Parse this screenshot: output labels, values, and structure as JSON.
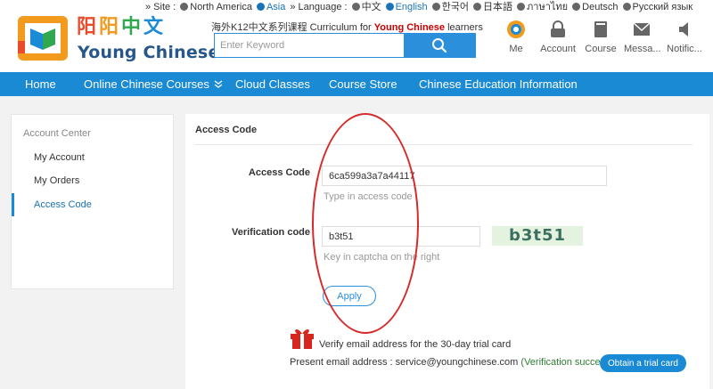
{
  "header": {
    "site_label": "» Site :",
    "sites": [
      {
        "label": "North America",
        "active": false
      },
      {
        "label": "Asia",
        "active": true
      }
    ],
    "language_label": "» Language :",
    "languages": [
      {
        "label": "中文",
        "active": false
      },
      {
        "label": "English",
        "active": true
      },
      {
        "label": "한국어",
        "active": false
      },
      {
        "label": "日本語",
        "active": false
      },
      {
        "label": "ภาษาไทย",
        "active": false
      },
      {
        "label": "Deutsch",
        "active": false
      },
      {
        "label": "Русский язык",
        "active": false
      }
    ],
    "logo_chars": [
      "阳",
      "阳",
      "中",
      "文"
    ],
    "logo_colors": [
      "#e94c2b",
      "#f29a1e",
      "#2fa84f",
      "#1b8bd6"
    ],
    "logo_text": "Young Chinese",
    "tagline_prefix": "海外K12中文系列课程 Curriculum for ",
    "tagline_brand": "Young Chinese",
    "tagline_suffix": " learners",
    "search_placeholder": "Enter Keyword",
    "user_nav": [
      {
        "label": "Me",
        "icon": "avatar-icon"
      },
      {
        "label": "Account",
        "icon": "account-icon"
      },
      {
        "label": "Course",
        "icon": "book-icon"
      },
      {
        "label": "Messa...",
        "icon": "mail-icon"
      },
      {
        "label": "Notific...",
        "icon": "speaker-icon"
      }
    ]
  },
  "nav": {
    "items": [
      "Home",
      "Online Chinese Courses",
      "Cloud Classes",
      "Course Store",
      "Chinese Education Information"
    ]
  },
  "sidebar": {
    "title": "Account Center",
    "items": [
      "My Account",
      "My Orders",
      "Access Code"
    ],
    "active_item": "Access Code"
  },
  "main": {
    "title": "Access Code",
    "access_code_label": "Access Code",
    "access_code_value": "6ca599a3a7a44117",
    "access_code_hint": "Type in access code",
    "verification_label": "Verification code",
    "verification_value": "b3t51",
    "verification_hint": "Key in captcha on the right",
    "captcha_text": "b3t51",
    "apply_label": "Apply",
    "trial_text": "Verify email address for the 30-day trial card",
    "email_prefix": "Present email address : service@youngchinese.com",
    "email_status": "(Verification successful)",
    "trial_button": "Obtain a trial card"
  },
  "colors": {
    "nav_blue": "#1a8ad5",
    "accent_blue": "#2b8fdc",
    "brand_red": "#cc0000",
    "annotation_red": "#d62b2b",
    "success_green": "#2e7d32"
  }
}
